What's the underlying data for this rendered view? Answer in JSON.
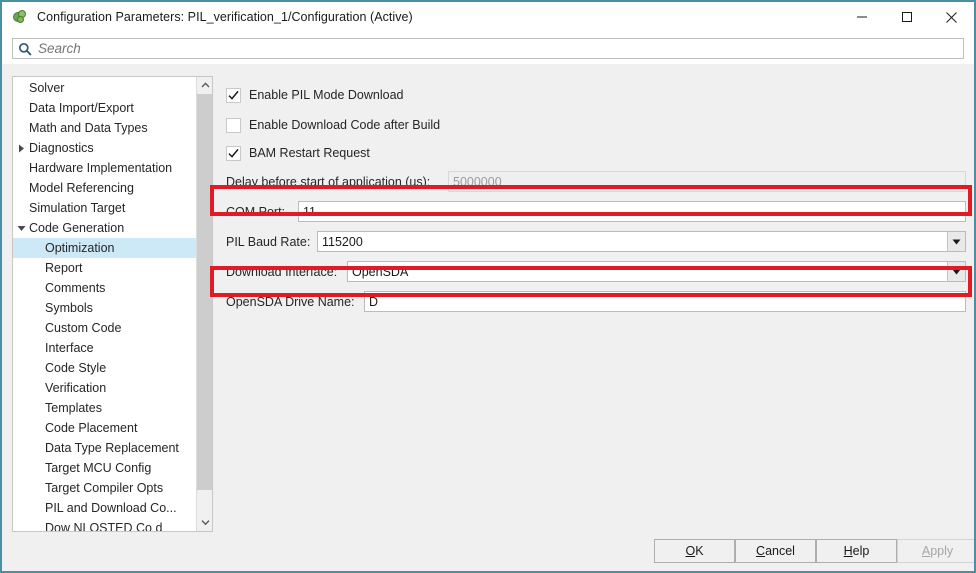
{
  "window": {
    "icon": "simulink-config-icon",
    "title": "Configuration Parameters: PIL_verification_1/Configuration (Active)",
    "minimize_label": "Minimize",
    "maximize_label": "Maximize",
    "close_label": "Close"
  },
  "search": {
    "icon": "search-icon",
    "placeholder": "Search",
    "value": ""
  },
  "sidebar": {
    "scroll_up_icon": "chevron-up-icon",
    "scroll_down_icon": "chevron-down-icon",
    "items": [
      {
        "label": "Solver",
        "level": 0,
        "twisty": "none",
        "selected": false
      },
      {
        "label": "Data Import/Export",
        "level": 0,
        "twisty": "none",
        "selected": false
      },
      {
        "label": "Math and Data Types",
        "level": 0,
        "twisty": "none",
        "selected": false
      },
      {
        "label": "Diagnostics",
        "level": 0,
        "twisty": "collapsed",
        "selected": false
      },
      {
        "label": "Hardware Implementation",
        "level": 0,
        "twisty": "none",
        "selected": false
      },
      {
        "label": "Model Referencing",
        "level": 0,
        "twisty": "none",
        "selected": false
      },
      {
        "label": "Simulation Target",
        "level": 0,
        "twisty": "none",
        "selected": false
      },
      {
        "label": "Code Generation",
        "level": 0,
        "twisty": "expanded",
        "selected": false
      },
      {
        "label": "Optimization",
        "level": 1,
        "twisty": "none",
        "selected": true
      },
      {
        "label": "Report",
        "level": 1,
        "twisty": "none",
        "selected": false
      },
      {
        "label": "Comments",
        "level": 1,
        "twisty": "none",
        "selected": false
      },
      {
        "label": "Symbols",
        "level": 1,
        "twisty": "none",
        "selected": false
      },
      {
        "label": "Custom Code",
        "level": 1,
        "twisty": "none",
        "selected": false
      },
      {
        "label": "Interface",
        "level": 1,
        "twisty": "none",
        "selected": false
      },
      {
        "label": "Code Style",
        "level": 1,
        "twisty": "none",
        "selected": false
      },
      {
        "label": "Verification",
        "level": 1,
        "twisty": "none",
        "selected": false
      },
      {
        "label": "Templates",
        "level": 1,
        "twisty": "none",
        "selected": false
      },
      {
        "label": "Code Placement",
        "level": 1,
        "twisty": "none",
        "selected": false
      },
      {
        "label": "Data Type Replacement",
        "level": 1,
        "twisty": "none",
        "selected": false
      },
      {
        "label": "Target MCU Config",
        "level": 1,
        "twisty": "none",
        "selected": false
      },
      {
        "label": "Target Compiler Opts",
        "level": 1,
        "twisty": "none",
        "selected": false
      },
      {
        "label": "PIL and Download Co...",
        "level": 1,
        "twisty": "none",
        "selected": false
      },
      {
        "label": "Dow NLOSTED Co d",
        "level": 1,
        "twisty": "none",
        "selected": false
      }
    ]
  },
  "panel": {
    "checkboxes": [
      {
        "label": "Enable PIL Mode Download",
        "checked": true,
        "enabled": true
      },
      {
        "label": "Enable Download Code after Build",
        "checked": false,
        "enabled": true
      },
      {
        "label": "BAM Restart Request",
        "checked": true,
        "enabled": true
      }
    ],
    "fields": [
      {
        "label": "Delay before start of application (us):",
        "value": "5000000",
        "type": "text",
        "enabled": false,
        "highlighted": false
      },
      {
        "label": "COM Port:",
        "value": "11",
        "type": "text",
        "enabled": true,
        "highlighted": true
      },
      {
        "label": "PIL Baud Rate:",
        "value": "115200",
        "type": "combo",
        "enabled": true,
        "highlighted": false
      },
      {
        "label": "Download Interface:",
        "value": "OpenSDA",
        "type": "combo",
        "enabled": true,
        "highlighted": false
      },
      {
        "label": "OpenSDA Drive Name:",
        "value": "D",
        "type": "text",
        "enabled": true,
        "highlighted": true
      }
    ],
    "combo_arrow_icon": "caret-down-icon"
  },
  "buttons": {
    "ok": {
      "before": "",
      "mnemonic": "O",
      "after": "K",
      "enabled": true
    },
    "cancel": {
      "before": "",
      "mnemonic": "C",
      "after": "ancel",
      "enabled": true
    },
    "help": {
      "before": "",
      "mnemonic": "H",
      "after": "elp",
      "enabled": true
    },
    "apply": {
      "before": "",
      "mnemonic": "A",
      "after": "pply",
      "enabled": false
    }
  },
  "colors": {
    "window_border": "#4b8fa6",
    "selection": "#cde8f7",
    "annotation_red": "#e01b24",
    "panel_bg": "#f0f0f0"
  }
}
